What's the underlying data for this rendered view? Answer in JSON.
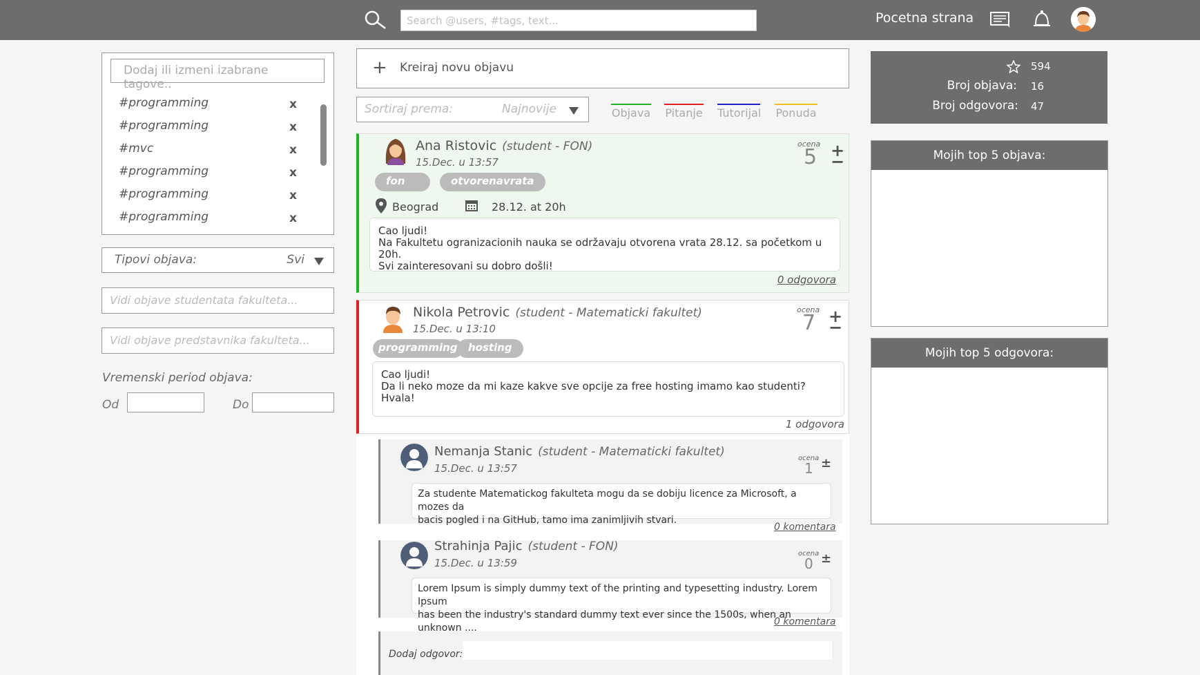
{
  "header": {
    "search_placeholder": "Search @users, #tags, text...",
    "home_label": "Pocetna strana"
  },
  "left": {
    "tags_placeholder": "Dodaj ili izmeni izabrane tagove..",
    "tags": [
      "#programming",
      "#programming",
      "#mvc",
      "#programming",
      "#programming",
      "#programming"
    ],
    "tag_remove": "x",
    "post_types_label": "Tipovi objava:",
    "post_types_value": "Svi",
    "students_placeholder": "Vidi objave studentata fakulteta...",
    "reps_placeholder": "Vidi objave predstavnika fakulteta...",
    "period_label": "Vremenski period objava:",
    "from_label": "Od",
    "to_label": "Do"
  },
  "feed": {
    "new_post_label": "Kreiraj novu objavu",
    "sort_label": "Sortiraj prema:",
    "sort_value": "Najnovije",
    "type_filters": [
      {
        "label": "Objava",
        "color": "#1db31d"
      },
      {
        "label": "Pitanje",
        "color": "#e02020"
      },
      {
        "label": "Tutorijal",
        "color": "#2020c8"
      },
      {
        "label": "Ponuda",
        "color": "#f0c020"
      }
    ],
    "ocena_label": "ocena",
    "posts": [
      {
        "name": "Ana Ristovic",
        "affiliation": "(student - FON)",
        "date": "15.Dec. u 13:57",
        "rating": "5",
        "tags": [
          "fon",
          "otvorenavrata"
        ],
        "location": "Beograd",
        "event_date": "28.12.  at 20h",
        "body": [
          "Cao ljudi!",
          "Na Fakultetu ogranizacionih nauka se održavaju otvorena vrata 28.12. sa početkom u 20h.",
          "Svi zainteresovani su dobro došli!"
        ],
        "replies": "0 odgovora"
      },
      {
        "name": "Nikola Petrovic",
        "affiliation": "(student - Matematicki fakultet)",
        "date": "15.Dec. u 13:10",
        "rating": "7",
        "tags": [
          "programming",
          "hosting"
        ],
        "body": [
          "Cao ljudi!",
          "Da li neko moze da mi kaze kakve sve opcije za free hosting imamo kao studenti?",
          "Hvala!"
        ],
        "replies": "1 odgovora"
      }
    ],
    "answers": [
      {
        "name": "Nemanja Stanic",
        "affiliation": "(student - Matematicki fakultet)",
        "date": "15.Dec. u 13:57",
        "rating": "1",
        "body": [
          "Za studente Matematickog fakulteta mogu da se dobiju licence za Microsoft, a mozes da",
          "bacis pogled i na GitHub, tamo ima zanimljivih stvari."
        ],
        "comments": "0 komentara"
      },
      {
        "name": "Strahinja Pajic",
        "affiliation": "(student - FON)",
        "date": "15.Dec. u 13:59",
        "rating": "0",
        "body": [
          "Lorem Ipsum is simply dummy text of the printing and typesetting industry. Lorem Ipsum",
          "has been the industry's standard dummy text ever since the 1500s, when an unknown ...."
        ],
        "comments": "0 komentara"
      }
    ],
    "add_answer_label": "Dodaj odgovor:"
  },
  "right": {
    "stars": "594",
    "posts_label": "Broj objava:",
    "posts_count": "16",
    "answers_label": "Broj odgovora:",
    "answers_count": "47",
    "top_posts_title": "Mojih top 5 objava:",
    "top_answers_title": "Mojih top 5 odgovora:"
  }
}
